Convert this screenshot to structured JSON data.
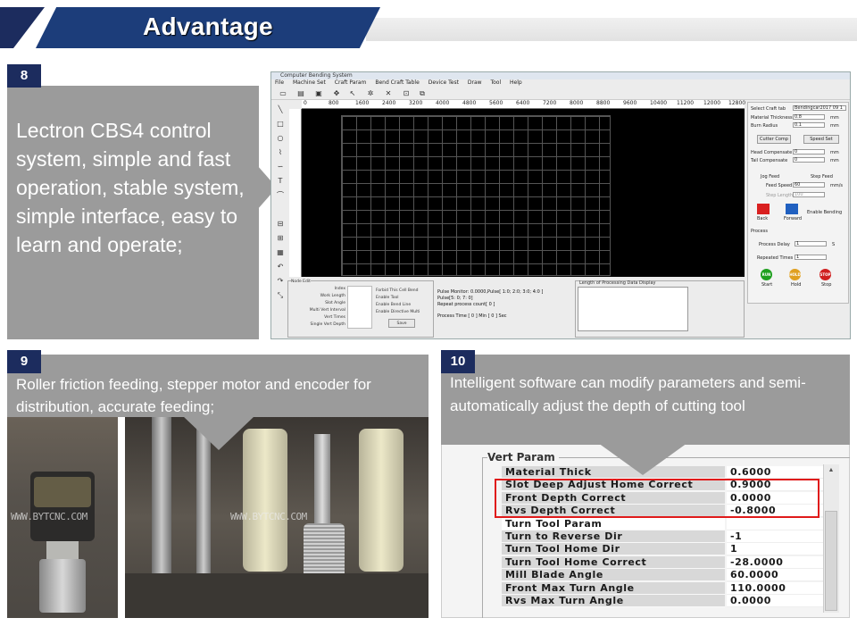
{
  "header": {
    "title": "Advantage"
  },
  "section8": {
    "number": "8",
    "text": "Lectron CBS4 control system, simple and fast operation, stable system, simple interface, easy to learn and operate;",
    "software": {
      "window_title": "Computer Bending System",
      "menu": [
        "File",
        "Machine Set",
        "Craft Param",
        "Bend Craft Table",
        "Device Test",
        "Draw",
        "Tool",
        "Help"
      ],
      "ruler_ticks": [
        "0",
        "800",
        "1600",
        "2400",
        "3200",
        "4000",
        "4800",
        "5600",
        "6400",
        "7200",
        "8000",
        "8800",
        "9600",
        "10400",
        "11200",
        "12000",
        "12800"
      ],
      "right_panel": {
        "craft_tab_label": "Select Craft tab",
        "craft_tab_value": "Bendingcar2017 09 1",
        "material_thickness_label": "Material Thickness",
        "material_thickness_value": "0.8",
        "burn_radius_label": "Burn Radius",
        "burn_radius_value": "0.1",
        "unit_mm": "mm",
        "cutter_comp": "Cutter Comp",
        "speed_set": "Speed Set",
        "head_compensate_label": "Head Compensate",
        "head_compensate_value": "0",
        "tail_compensate_label": "Tail Compensate",
        "tail_compensate_value": "0",
        "jog_feed": "Jog Feed",
        "step_feed": "Step Feed",
        "feed_speed_label": "Feed Speed",
        "feed_speed_value": "60",
        "feed_speed_unit": "mm/s",
        "step_length_label": "Step Length",
        "step_length_value": "100",
        "back": "Back",
        "forward": "Forward",
        "enable_bending": "Enable Bending",
        "process_title": "Process",
        "process_delay_label": "Process Delay",
        "process_delay_value": "1",
        "process_delay_unit": "S",
        "repeated_times_label": "Repeated Times",
        "repeated_times_value": "1",
        "run": "RUN",
        "hold": "HOLD",
        "stop": "STOP",
        "start_label": "Start",
        "hold_label": "Hold",
        "stop_label": "Stop"
      },
      "node_edit": {
        "title": "Node Edit",
        "fields": [
          "Index",
          "Work Length",
          "Slot Angle",
          "Multi Vert Interval",
          "Vert Times",
          "Single Vert Depth"
        ],
        "checks": [
          "Forbid This Cell Bend",
          "Enable Tool",
          "Enable Bend Line",
          "Enable Directive Multi"
        ],
        "save": "Save"
      },
      "status": {
        "pulse_monitor": "Pulse Monitor: 0.0000,Pulse[ 1:0; 2:0; 3:0; 4:0 ]",
        "pulse2": "Pulse[5: 0; 7: 0]",
        "repeat_count": "Repeat process count[ 0 ]",
        "process_time": "Process Time [ 0 ] Min [ 0 ] Sec"
      },
      "length_panel_title": "Length of Processing Data Display"
    }
  },
  "section9": {
    "number": "9",
    "text": "Roller friction feeding, stepper motor and encoder for distribution, accurate feeding;",
    "watermark": "WWW.BYTCNC.COM"
  },
  "section10": {
    "number": "10",
    "text": "Intelligent software can modify parameters and semi-automatically adjust the depth of cutting tool",
    "panel_title": "Vert Param",
    "params": [
      {
        "name": "Material Thick",
        "value": "0.6000"
      },
      {
        "name": "Slot Deep Adjust Home Correct",
        "value": "0.9000"
      },
      {
        "name": "Front Depth Correct",
        "value": "0.0000"
      },
      {
        "name": "Rvs Depth Correct",
        "value": "-0.8000"
      },
      {
        "name": "Turn Tool Param",
        "value": ""
      },
      {
        "name": "Turn to Reverse Dir",
        "value": "-1"
      },
      {
        "name": "Turn Tool Home Dir",
        "value": "1"
      },
      {
        "name": "Turn Tool Home Correct",
        "value": "-28.0000"
      },
      {
        "name": "Mill Blade Angle",
        "value": "60.0000"
      },
      {
        "name": "Front Max Turn Angle",
        "value": "110.0000"
      },
      {
        "name": "Rvs Max Turn Angle",
        "value": "0.0000"
      }
    ],
    "highlight_color": "#e01b1b"
  },
  "colors": {
    "navy": "#1c3d7a",
    "dark_navy": "#1c2c5e",
    "callout_gray": "#9b9b9b"
  }
}
